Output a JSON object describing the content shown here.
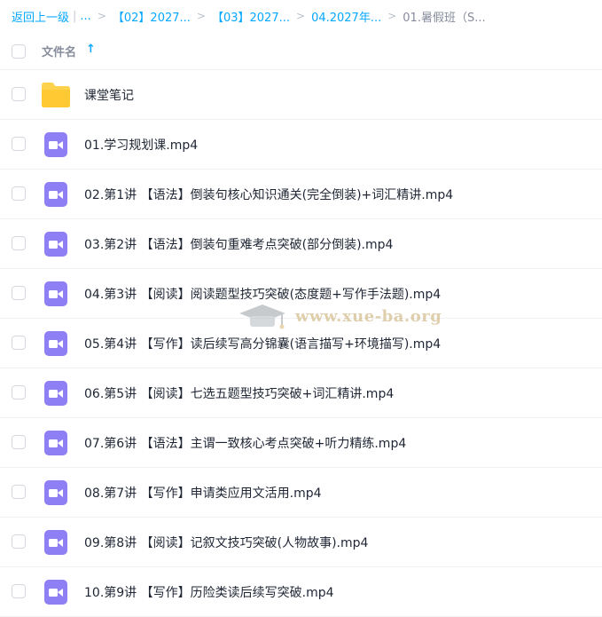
{
  "breadcrumb": {
    "back": "返回上一级",
    "separator": "|",
    "ellipsis": "...",
    "arrow": ">",
    "items": [
      "【02】2027...",
      "【03】2027...",
      "04.2027年...",
      "01.暑假班（S..."
    ]
  },
  "header": {
    "column_name": "文件名",
    "sort_icon": "arrow-up-icon"
  },
  "files": [
    {
      "name": "课堂笔记",
      "type": "folder"
    },
    {
      "name": "01.学习规划课.mp4",
      "type": "video"
    },
    {
      "name": "02.第1讲 【语法】倒装句核心知识通关(完全倒装)+词汇精讲.mp4",
      "type": "video"
    },
    {
      "name": "03.第2讲 【语法】倒装句重难考点突破(部分倒装).mp4",
      "type": "video"
    },
    {
      "name": "04.第3讲 【阅读】阅读题型技巧突破(态度题+写作手法题).mp4",
      "type": "video"
    },
    {
      "name": "05.第4讲 【写作】读后续写高分锦囊(语言描写+环境描写).mp4",
      "type": "video"
    },
    {
      "name": "06.第5讲 【阅读】七选五题型技巧突破+词汇精讲.mp4",
      "type": "video"
    },
    {
      "name": "07.第6讲 【语法】主谓一致核心考点突破+听力精练.mp4",
      "type": "video"
    },
    {
      "name": "08.第7讲 【写作】申请类应用文活用.mp4",
      "type": "video"
    },
    {
      "name": "09.第8讲 【阅读】记叙文技巧突破(人物故事).mp4",
      "type": "video"
    },
    {
      "name": "10.第9讲 【写作】历险类读后续写突破.mp4",
      "type": "video"
    }
  ],
  "watermark": {
    "text": "www.xue-ba.org"
  },
  "colors": {
    "accent": "#06a7ff",
    "folder": "#ffd24d",
    "video": "#8f7ff5"
  }
}
